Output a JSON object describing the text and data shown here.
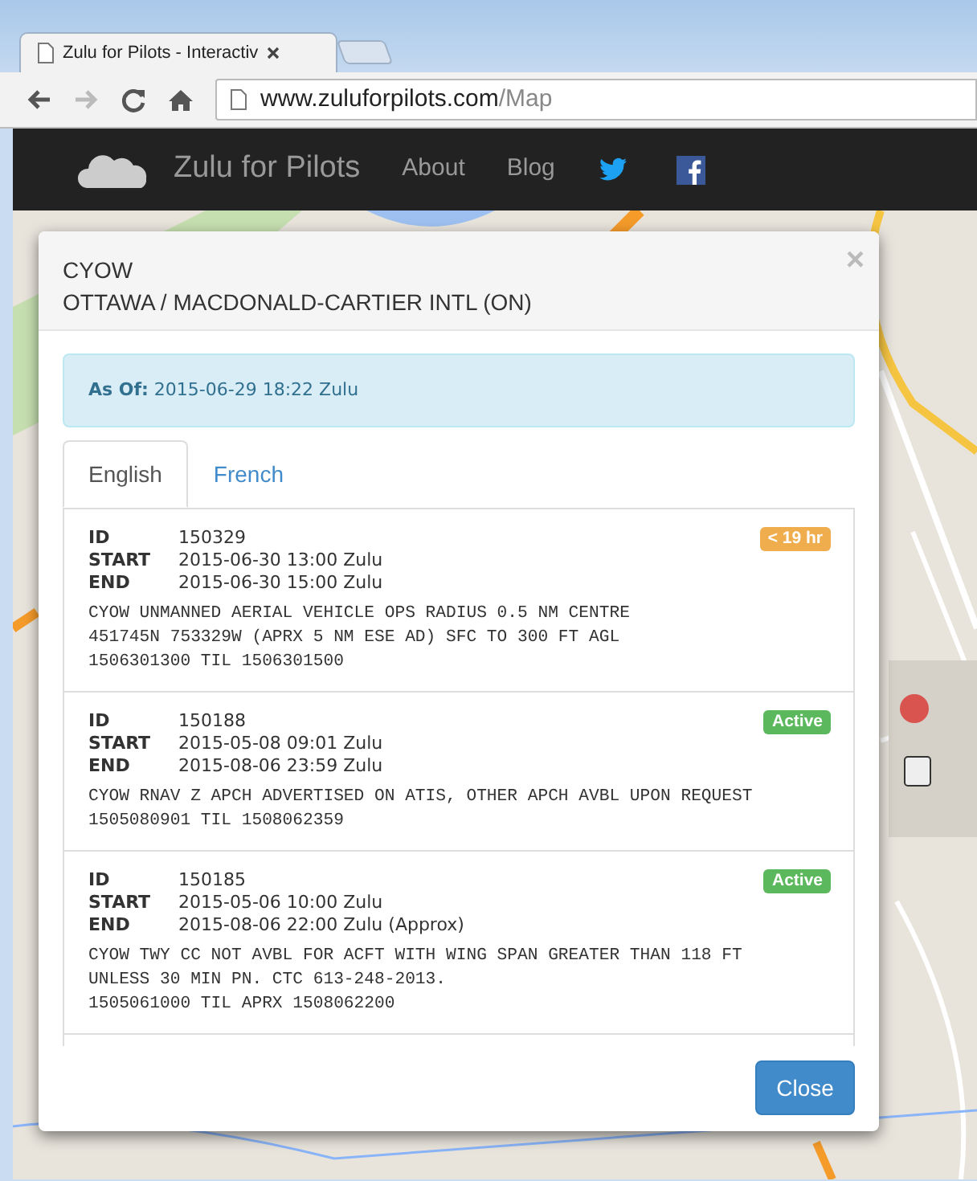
{
  "browser": {
    "tab_title": "Zulu for Pilots - Interactiv",
    "url_host": "www.zuluforpilots.com",
    "url_path": "/Map"
  },
  "navbar": {
    "brand": "Zulu for Pilots",
    "links": [
      "About",
      "Blog"
    ]
  },
  "modal": {
    "code": "CYOW",
    "airport": "OTTAWA / MACDONALD-CARTIER INTL (ON)",
    "close_symbol": "×",
    "alert": {
      "label": "As Of:",
      "value": "2015-06-29 18:22 Zulu"
    },
    "tabs": [
      {
        "label": "English",
        "selected": true
      },
      {
        "label": "French",
        "selected": false
      }
    ],
    "notams": [
      {
        "fields": [
          {
            "label": "ID",
            "value": "150329"
          },
          {
            "label": "START",
            "value": "2015-06-30 13:00 Zulu"
          },
          {
            "label": "END",
            "value": "2015-06-30 15:00 Zulu"
          }
        ],
        "badge": {
          "text": "< 19 hr",
          "kind": "warning"
        },
        "text_lines": [
          "CYOW UNMANNED AERIAL VEHICLE OPS RADIUS 0.5 NM CENTRE",
          "451745N 753329W (APRX 5 NM ESE AD) SFC TO 300 FT AGL",
          "1506301300 TIL 1506301500"
        ]
      },
      {
        "fields": [
          {
            "label": "ID",
            "value": "150188"
          },
          {
            "label": "START",
            "value": "2015-05-08 09:01 Zulu"
          },
          {
            "label": "END",
            "value": "2015-08-06 23:59 Zulu"
          }
        ],
        "badge": {
          "text": "Active",
          "kind": "success"
        },
        "text_lines": [
          "CYOW RNAV Z APCH ADVERTISED ON ATIS, OTHER APCH AVBL UPON REQUEST",
          "1505080901 TIL 1508062359"
        ]
      },
      {
        "fields": [
          {
            "label": "ID",
            "value": "150185"
          },
          {
            "label": "START",
            "value": "2015-05-06 10:00 Zulu"
          },
          {
            "label": "END",
            "value": "2015-08-06 22:00 Zulu (Approx)"
          }
        ],
        "badge": {
          "text": "Active",
          "kind": "success"
        },
        "text_lines": [
          "CYOW TWY CC NOT AVBL FOR ACFT WITH WING SPAN GREATER THAN 118 FT",
          "UNLESS 30 MIN PN. CTC 613-248-2013.",
          "1505061000 TIL APRX 1508062200"
        ]
      }
    ],
    "button": "Close"
  }
}
